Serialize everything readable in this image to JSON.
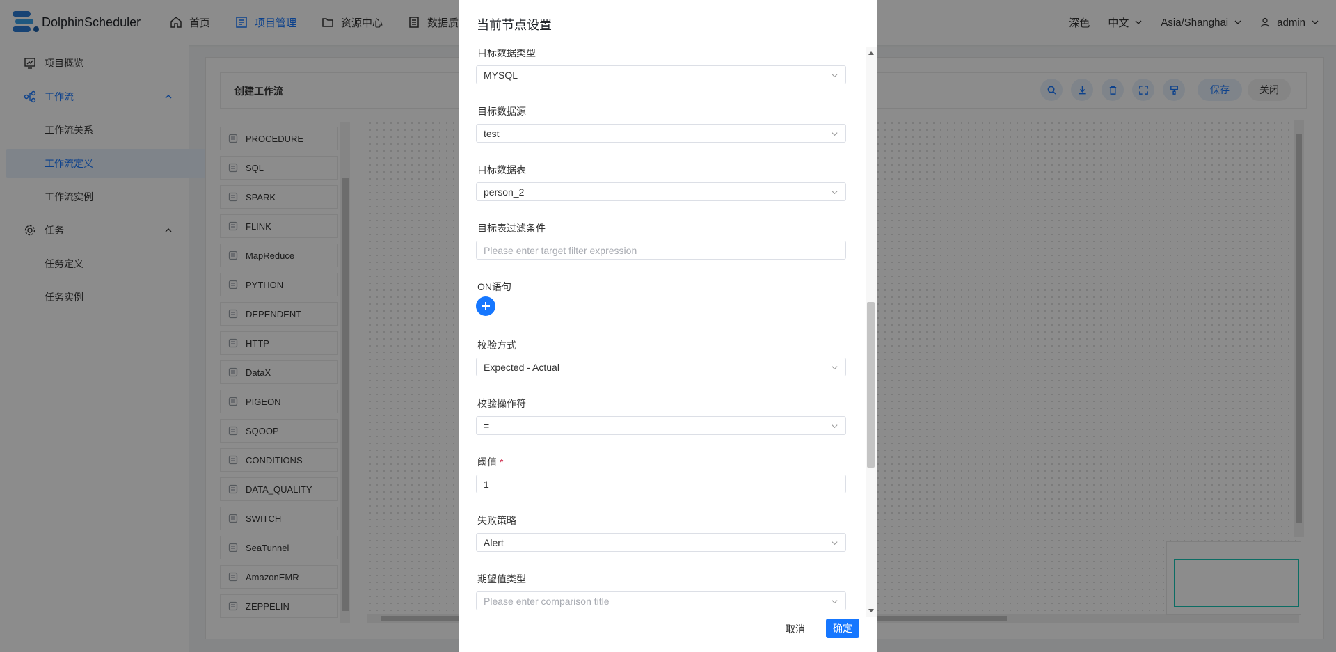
{
  "app": {
    "name": "DolphinScheduler"
  },
  "topnav": [
    {
      "label": "首页",
      "icon": "home-icon"
    },
    {
      "label": "项目管理",
      "icon": "project-icon",
      "active": true
    },
    {
      "label": "资源中心",
      "icon": "folder-icon"
    },
    {
      "label": "数据质量",
      "icon": "data-quality-icon"
    }
  ],
  "header_right": {
    "theme": "深色",
    "language": "中文",
    "timezone": "Asia/Shanghai",
    "user": "admin"
  },
  "sidebar": {
    "overview": "项目概览",
    "workflow": "工作流",
    "workflow_relation": "工作流关系",
    "workflow_definition": "工作流定义",
    "workflow_instance": "工作流实例",
    "task": "任务",
    "task_definition": "任务定义",
    "task_instance": "任务实例"
  },
  "toolbar": {
    "title": "创建工作流",
    "save": "保存",
    "close": "关闭"
  },
  "tasks": [
    "PROCEDURE",
    "SQL",
    "SPARK",
    "FLINK",
    "MapReduce",
    "PYTHON",
    "DEPENDENT",
    "HTTP",
    "DataX",
    "PIGEON",
    "SQOOP",
    "CONDITIONS",
    "DATA_QUALITY",
    "SWITCH",
    "SeaTunnel",
    "AmazonEMR",
    "ZEPPELIN"
  ],
  "modal": {
    "title": "当前节点设置",
    "fields": {
      "target_db_type": {
        "label": "目标数据类型",
        "value": "MYSQL"
      },
      "target_datasource": {
        "label": "目标数据源",
        "value": "test"
      },
      "target_table": {
        "label": "目标数据表",
        "value": "person_2"
      },
      "target_filter": {
        "label": "目标表过滤条件",
        "placeholder": "Please enter target filter expression"
      },
      "on_clause": {
        "label": "ON语句"
      },
      "check_type": {
        "label": "校验方式",
        "value": "Expected - Actual"
      },
      "operator": {
        "label": "校验操作符",
        "value": "="
      },
      "threshold": {
        "label": "阈值",
        "required": "*",
        "value": "1"
      },
      "failure_strategy": {
        "label": "失败策略",
        "value": "Alert"
      },
      "comparison_type": {
        "label": "期望值类型",
        "placeholder": "Please enter comparison title"
      }
    },
    "cancel": "取消",
    "confirm": "确定"
  },
  "colors": {
    "primary": "#1677ff",
    "minimap_accent": "#17c6b6",
    "required": "#d03050"
  }
}
